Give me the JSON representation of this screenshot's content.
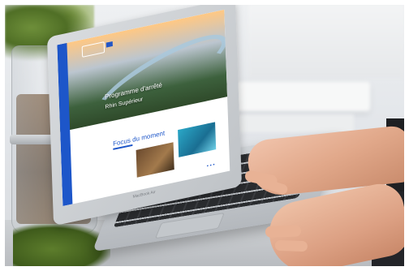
{
  "scene": {
    "subject": "",
    "screen": {
      "hero_line1": "Programme d'arrêté",
      "hero_line2": "Rhin Supérieur",
      "focus_title": "Focus du moment",
      "pager": "• • •",
      "bezel_label": "MacBook Air"
    }
  },
  "colors": {
    "accent_blue": "#1d56c9",
    "skin": "#e1a88a",
    "desk": "#c4c7cb"
  }
}
